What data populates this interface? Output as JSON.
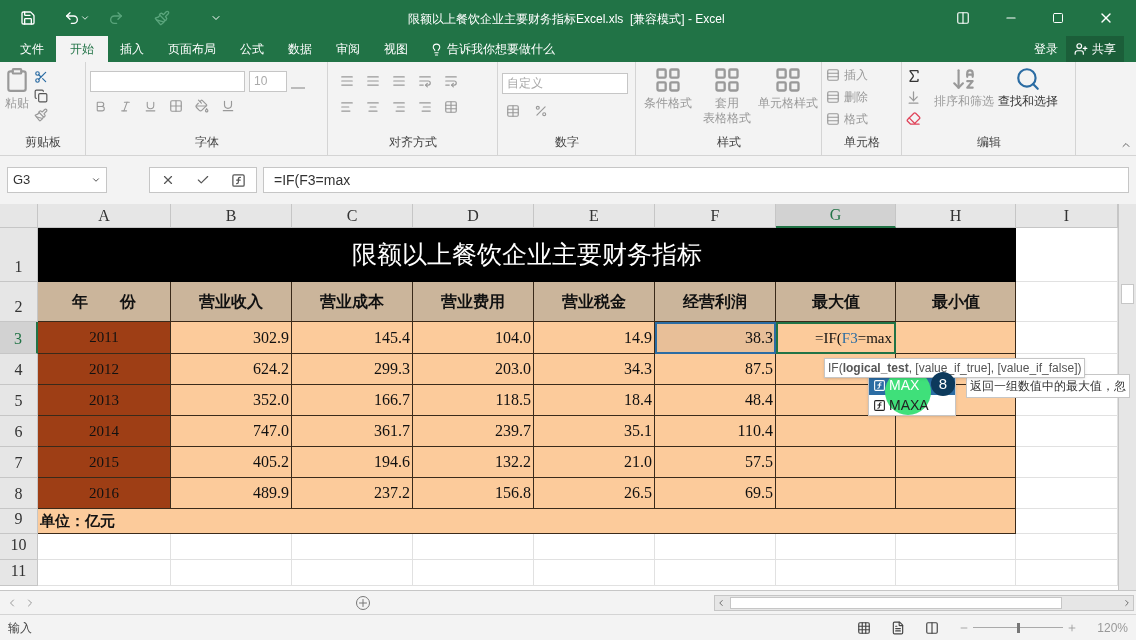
{
  "window": {
    "title": "限额以上餐饮企业主要财务指标Excel.xls  [兼容模式] - Excel"
  },
  "menu_tabs": [
    {
      "label": "文件",
      "selected": false
    },
    {
      "label": "开始",
      "selected": true
    },
    {
      "label": "插入",
      "selected": false
    },
    {
      "label": "页面布局",
      "selected": false
    },
    {
      "label": "公式",
      "selected": false
    },
    {
      "label": "数据",
      "selected": false
    },
    {
      "label": "审阅",
      "selected": false
    },
    {
      "label": "视图",
      "selected": false
    }
  ],
  "tell_me": "告诉我你想要做什么",
  "sign_in": "登录",
  "share": "共享",
  "ribbon": {
    "paste": "粘贴",
    "clipboard": "剪贴板",
    "font_size": "10",
    "font": "字体",
    "alignment": "对齐方式",
    "number_format": "自定义",
    "number": "数字",
    "styles": [
      {
        "lines": [
          "条件格式"
        ]
      },
      {
        "lines": [
          "套用",
          "表格格式"
        ]
      },
      {
        "lines": [
          "单元格样式"
        ]
      }
    ],
    "styles_group": "样式",
    "cells": [
      {
        "label": "插入"
      },
      {
        "label": "删除"
      },
      {
        "label": "格式"
      }
    ],
    "cells_group": "单元格",
    "sort": "排序和筛选",
    "find": "查找和选择",
    "editing": "编辑"
  },
  "name_box": "G3",
  "formula": "=IF(F3=max",
  "columns": [
    "A",
    "B",
    "C",
    "D",
    "E",
    "F",
    "G",
    "H",
    "I"
  ],
  "rows": [
    "1",
    "2",
    "3",
    "4",
    "5",
    "6",
    "7",
    "8",
    "9",
    "10",
    "11"
  ],
  "sheet_title": "限额以上餐饮企业主要财务指标",
  "headers": [
    "年　　份",
    "营业收入",
    "营业成本",
    "营业费用",
    "营业税金",
    "经营利润",
    "最大值",
    "最小值"
  ],
  "data": [
    {
      "year": "2011",
      "values": [
        "302.9",
        "145.4",
        "104.0",
        "14.9",
        "38.3"
      ]
    },
    {
      "year": "2012",
      "values": [
        "624.2",
        "299.3",
        "203.0",
        "34.3",
        "87.5"
      ]
    },
    {
      "year": "2013",
      "values": [
        "352.0",
        "166.7",
        "118.5",
        "18.4",
        "48.4"
      ]
    },
    {
      "year": "2014",
      "values": [
        "747.0",
        "361.7",
        "239.7",
        "35.1",
        "110.4"
      ]
    },
    {
      "year": "2015",
      "values": [
        "405.2",
        "194.6",
        "132.2",
        "21.0",
        "57.5"
      ]
    },
    {
      "year": "2016",
      "values": [
        "489.9",
        "237.2",
        "156.8",
        "26.5",
        "69.5"
      ]
    }
  ],
  "unit": "单位：亿元",
  "cell_editor": [
    {
      "text": "=IF(",
      "ref": false
    },
    {
      "text": "F3",
      "ref": true
    },
    {
      "text": "=max",
      "ref": false
    }
  ],
  "arg_tip": "IF(**logical_test**, [value_if_true], [value_if_false])",
  "autocomplete": [
    {
      "label": "MAX",
      "selected": true
    },
    {
      "label": "MAXA",
      "selected": false
    }
  ],
  "step_badge": "8",
  "func_desc": "返回一组数值中的最大值，忽",
  "status": "输入",
  "zoom_slider": {
    "level": 0.5
  },
  "zoom": "120%"
}
